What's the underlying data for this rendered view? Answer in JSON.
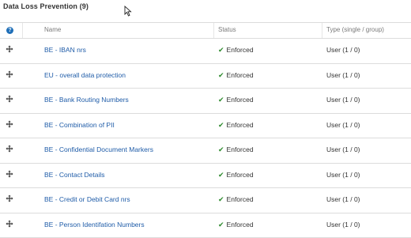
{
  "section": {
    "title": "Data Loss Prevention (9)"
  },
  "table": {
    "help_icon": "?",
    "columns": {
      "name": "Name",
      "status": "Status",
      "type": "Type (single / group)"
    },
    "rows": [
      {
        "name": "BE - IBAN nrs",
        "status": "Enforced",
        "type": "User (1 / 0)"
      },
      {
        "name": "EU - overall data protection",
        "status": "Enforced",
        "type": "User (1 / 0)"
      },
      {
        "name": "BE - Bank Routing Numbers",
        "status": "Enforced",
        "type": "User (1 / 0)"
      },
      {
        "name": "BE - Combination of PII",
        "status": "Enforced",
        "type": "User (1 / 0)"
      },
      {
        "name": "BE - Confidential Document Markers",
        "status": "Enforced",
        "type": "User (1 / 0)"
      },
      {
        "name": "BE - Contact Details",
        "status": "Enforced",
        "type": "User (1 / 0)"
      },
      {
        "name": "BE - Credit or Debit Card nrs",
        "status": "Enforced",
        "type": "User (1 / 0)"
      },
      {
        "name": "BE - Person Identifation Numbers",
        "status": "Enforced",
        "type": "User (1 / 0)"
      }
    ]
  },
  "icons": {
    "drag": "drag-handle-icon",
    "check": "checkmark-icon",
    "help": "help-icon",
    "cursor": "mouse-cursor-icon"
  },
  "colors": {
    "link": "#1f5ca8",
    "check": "#2e8b2e",
    "help": "#1f6fb8"
  }
}
